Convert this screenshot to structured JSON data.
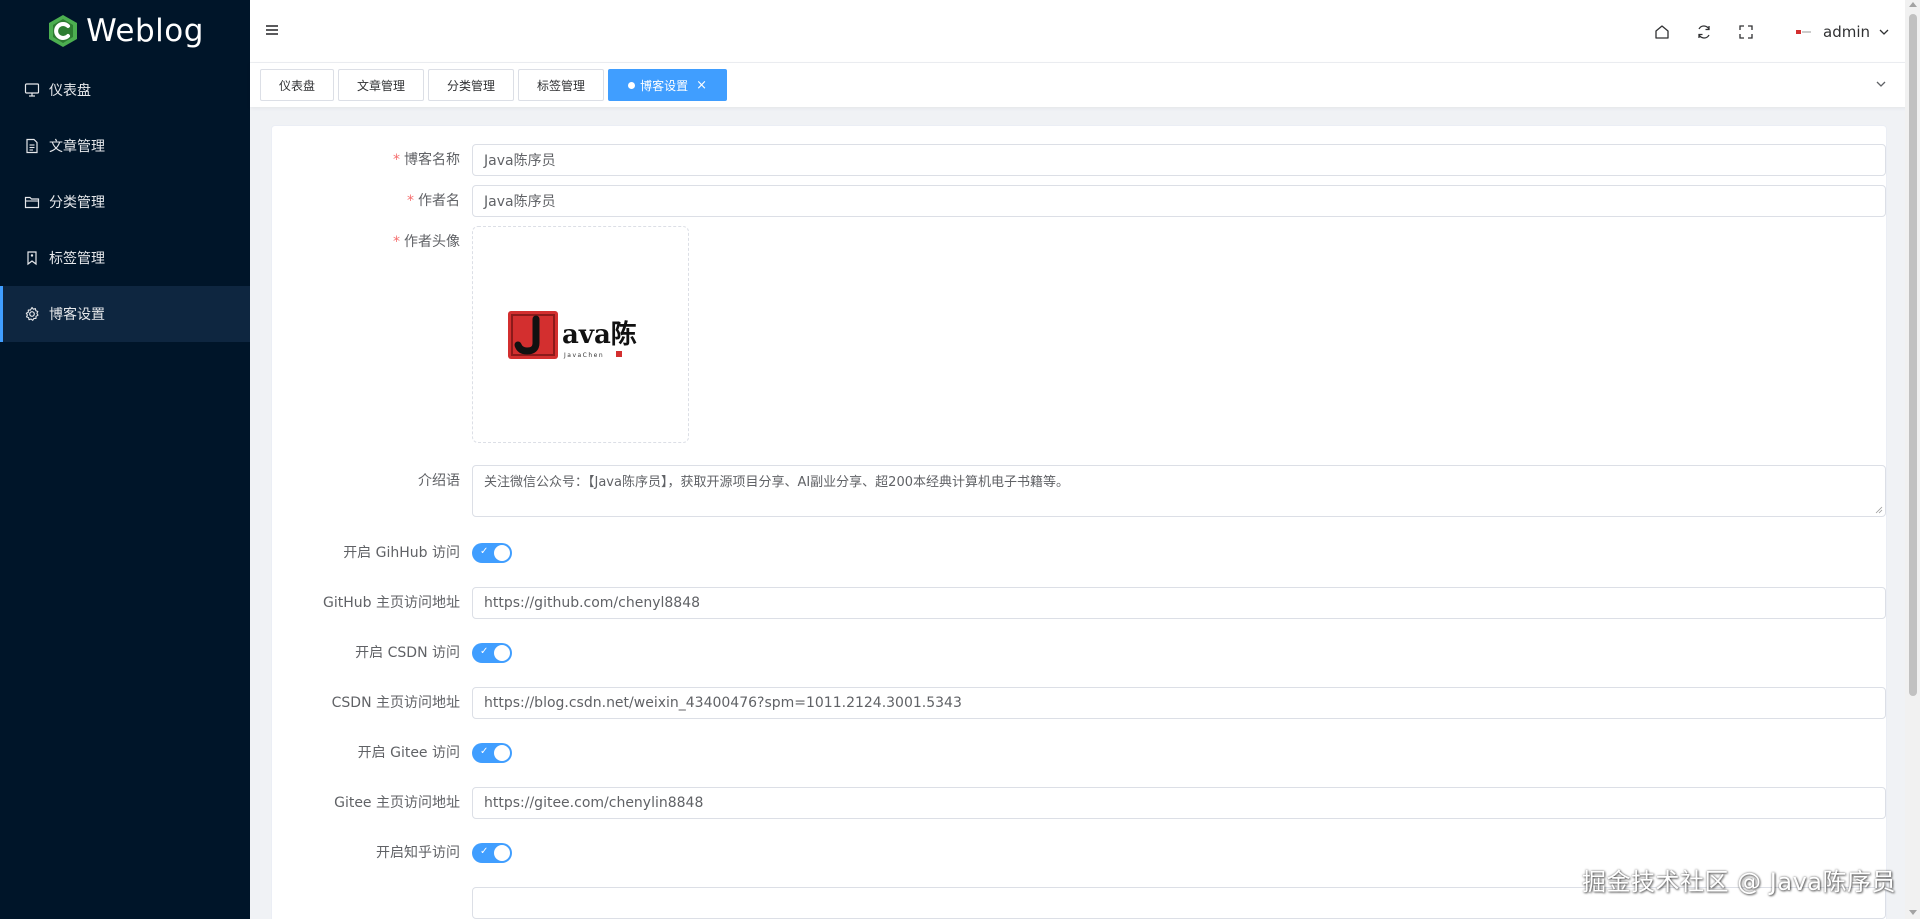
{
  "app": {
    "logo_text": "Weblog"
  },
  "colors": {
    "sidebar_bg": "#001529",
    "accent": "#409eff",
    "required": "#f56c6c"
  },
  "sidebar": {
    "items": [
      {
        "label": "仪表盘",
        "icon": "monitor-icon"
      },
      {
        "label": "文章管理",
        "icon": "document-icon"
      },
      {
        "label": "分类管理",
        "icon": "folder-icon"
      },
      {
        "label": "标签管理",
        "icon": "tag-icon"
      },
      {
        "label": "博客设置",
        "icon": "gear-icon",
        "active": true
      }
    ]
  },
  "header": {
    "user_name": "admin"
  },
  "tabs": [
    {
      "label": "仪表盘"
    },
    {
      "label": "文章管理"
    },
    {
      "label": "分类管理"
    },
    {
      "label": "标签管理"
    },
    {
      "label": "博客设置",
      "active": true,
      "close": "×"
    }
  ],
  "form": {
    "blog_name": {
      "label": "博客名称",
      "value": "Java陈序员"
    },
    "author": {
      "label": "作者名",
      "value": "Java陈序员"
    },
    "avatar": {
      "label": "作者头像",
      "logo_text": "ava陈",
      "logo_sub": "JavaChen"
    },
    "intro": {
      "label": "介绍语",
      "value": "关注微信公众号：【Java陈序员】，获取开源项目分享、AI副业分享、超200本经典计算机电子书籍等。"
    },
    "github_switch": {
      "label": "开启 GihHub 访问",
      "on": true
    },
    "github_url": {
      "label": "GitHub 主页访问地址",
      "value": "https://github.com/chenyl8848"
    },
    "csdn_switch": {
      "label": "开启 CSDN 访问",
      "on": true
    },
    "csdn_url": {
      "label": "CSDN 主页访问地址",
      "value": "https://blog.csdn.net/weixin_43400476?spm=1011.2124.3001.5343"
    },
    "gitee_switch": {
      "label": "开启 Gitee 访问",
      "on": true
    },
    "gitee_url": {
      "label": "Gitee 主页访问地址",
      "value": "https://gitee.com/chenylin8848"
    },
    "zhihu_switch": {
      "label": "开启知乎访问",
      "on": true
    }
  },
  "watermark": "掘金技术社区 @ Java陈序员"
}
